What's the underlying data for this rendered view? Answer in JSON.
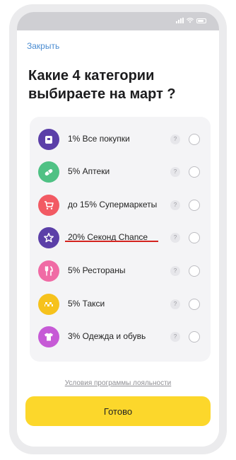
{
  "header": {
    "close_label": "Закрыть",
    "title": "Какие 4 категории выбираете на март ?"
  },
  "options": [
    {
      "label": "1% Все покупки",
      "icon": "shopping-bag-icon",
      "color": "#5b3fa8"
    },
    {
      "label": "5% Аптеки",
      "icon": "pill-icon",
      "color": "#4fc184"
    },
    {
      "label": "до 15% Супермаркеты",
      "icon": "shopping-cart-icon",
      "color": "#f25a63"
    },
    {
      "label": "20% Секонд Chance",
      "icon": "star-icon",
      "color": "#5b3fa8"
    },
    {
      "label": "5% Рестораны",
      "icon": "fork-knife-icon",
      "color": "#f06ba5"
    },
    {
      "label": "5% Такси",
      "icon": "taxi-checker-icon",
      "color": "#f6c21c"
    },
    {
      "label": "3% Одежда и обувь",
      "icon": "tshirt-icon",
      "color": "#c65ad6"
    }
  ],
  "help_symbol": "?",
  "footer": {
    "terms_link": "Условия программы лояльности",
    "done_label": "Готово"
  },
  "colors": {
    "accent_yellow": "#fcd72b",
    "link_blue": "#4a8cd1",
    "annotation_red": "#d4231f"
  }
}
